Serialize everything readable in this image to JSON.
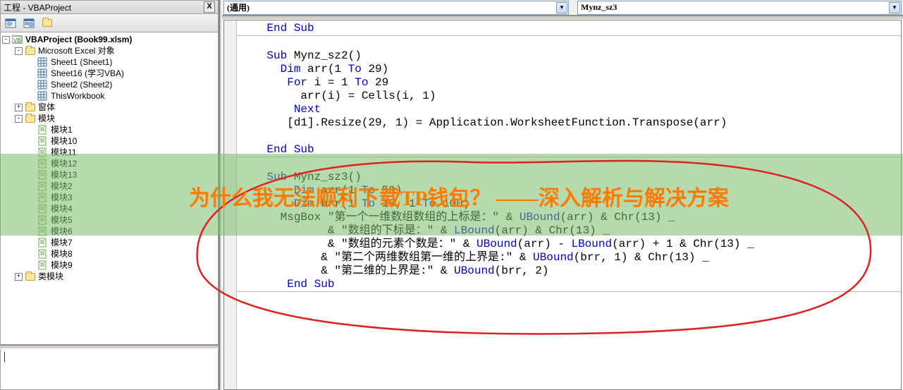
{
  "project_pane": {
    "title": "工程 - VBAProject",
    "close": "X",
    "root": {
      "label": "VBAProject (Book99.xlsm)"
    },
    "excel_objects_label": "Microsoft Excel 对象",
    "sheets": [
      "Sheet1 (Sheet1)",
      "Sheet16 (学习VBA)",
      "Sheet2 (Sheet2)",
      "ThisWorkbook"
    ],
    "forms_label": "窗体",
    "modules_label": "模块",
    "modules": [
      "模块1",
      "模块10",
      "模块11",
      "模块12",
      "模块13",
      "模块2",
      "模块3",
      "模块4",
      "模块5",
      "模块6",
      "模块7",
      "模块8",
      "模块9"
    ],
    "class_modules_label": "类模块"
  },
  "code_header": {
    "object": "(通用)",
    "proc": "Mynz_sz3"
  },
  "code": {
    "l1": "    End Sub",
    "l2": "",
    "l3": "    Sub Mynz_sz2()",
    "l4": "      Dim arr(1 To 29)",
    "l5": "       For i = 1 To 29",
    "l6": "         arr(i) = Cells(i, 1)",
    "l7": "        Next",
    "l8": "       [d1].Resize(29, 1) = Application.WorksheetFunction.Transpose(arr)",
    "l9": "",
    "l10": "    End Sub",
    "l11": "",
    "l12": "    Sub Mynz_sz3()",
    "l13": "        Dim arr(1 To 50)",
    "l14": "        Dim brr(1 To 10, 1 To 100)",
    "l15a": "      MsgBox \"第一个一维数组数组的上标是：\" & ",
    "l15b": "UBound",
    "l15c": "(arr) & Chr(13) _",
    "l16a": "             & \"数组的下标是：\" & ",
    "l16b": "LBound",
    "l16c": "(arr) & Chr(13) _",
    "l17a": "             & \"数组的元素个数是：\" & ",
    "l17d": "(arr) - ",
    "l17f": "(arr) + 1 & Chr(13) _",
    "l18a": "            & \"第二个两维数组第一维的上界是:\" & ",
    "l18c": "(brr, 1) & Chr(13) _",
    "l19a": "            & \"第二维的上界是:\" & ",
    "l19c": "(brr, 2)",
    "l20": "       End Sub"
  },
  "overlay": {
    "text": "为什么我无法顺利下载TP钱包？ ——深入解析与解决方案"
  }
}
